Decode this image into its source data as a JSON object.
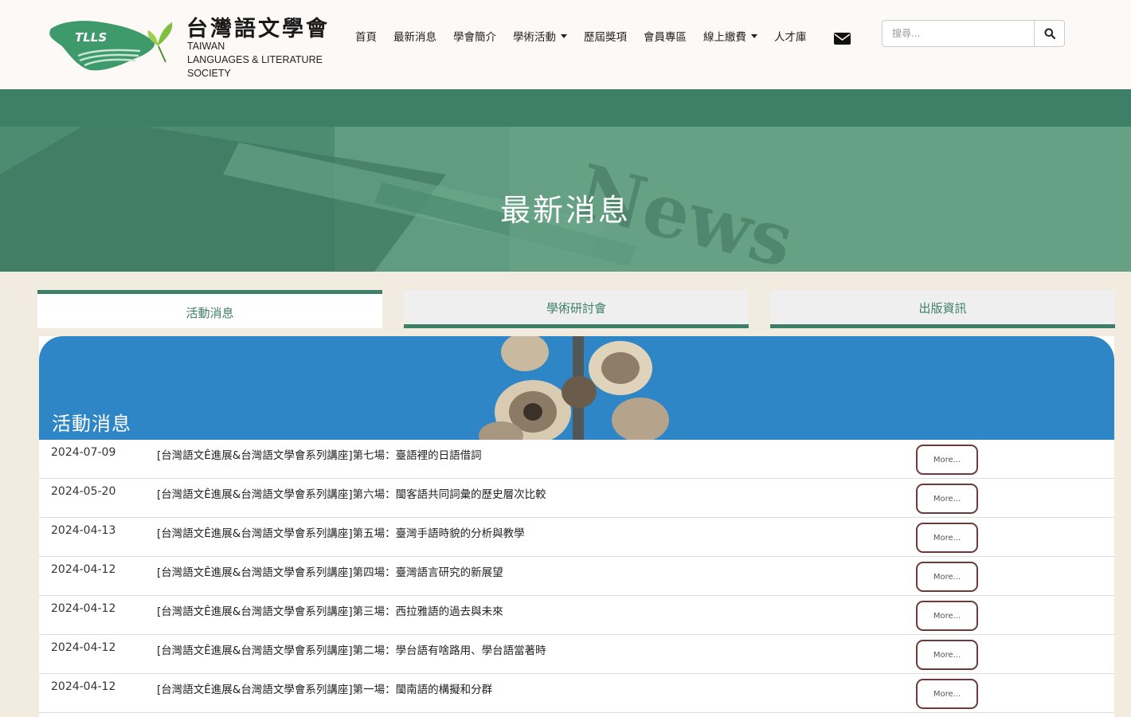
{
  "site": {
    "logo_mark_text": "TLLS",
    "title": "台灣語文學會",
    "subtitle_lines": [
      "TAIWAN",
      "LANGUAGES & LITERATURE",
      "SOCIETY"
    ]
  },
  "nav": {
    "items": [
      {
        "label": "首頁",
        "dropdown": false
      },
      {
        "label": "最新消息",
        "dropdown": false
      },
      {
        "label": "學會簡介",
        "dropdown": false
      },
      {
        "label": "學術活動",
        "dropdown": true
      },
      {
        "label": "歷屆獎項",
        "dropdown": false
      },
      {
        "label": "會員專區",
        "dropdown": false
      },
      {
        "label": "線上繳費",
        "dropdown": true
      },
      {
        "label": "人才庫",
        "dropdown": false
      }
    ],
    "mail_icon": "envelope-icon"
  },
  "search": {
    "placeholder": "搜尋...",
    "button_icon": "search-icon"
  },
  "hero": {
    "title": "最新消息",
    "background_word": "News"
  },
  "tabs": [
    {
      "label": "活動消息",
      "active": true
    },
    {
      "label": "學術研討會",
      "active": false
    },
    {
      "label": "出版資訊",
      "active": false
    }
  ],
  "panel": {
    "title": "活動消息",
    "more_label": "More...",
    "rows": [
      {
        "date": "2024-07-09",
        "title": "[台灣語文Ê進展&台灣語文學會系列講座]第七場：臺語裡的日語借詞"
      },
      {
        "date": "2024-05-20",
        "title": "[台灣語文Ê進展&台灣語文學會系列講座]第六場：閩客語共同詞彙的歷史層次比較"
      },
      {
        "date": "2024-04-13",
        "title": "[台灣語文Ê進展&台灣語文學會系列講座]第五場：臺灣手語時貌的分析與教學"
      },
      {
        "date": "2024-04-12",
        "title": "[台灣語文Ê進展&台灣語文學會系列講座]第四場：臺灣語言研究的新展望"
      },
      {
        "date": "2024-04-12",
        "title": "[台灣語文Ê進展&台灣語文學會系列講座]第三場：西拉雅語的過去與未來"
      },
      {
        "date": "2024-04-12",
        "title": "[台灣語文Ê進展&台灣語文學會系列講座]第二場：學台語有啥路用、學台語當著時"
      },
      {
        "date": "2024-04-12",
        "title": "[台灣語文Ê進展&台灣語文學會系列講座]第一場：閩南語的構擬和分群"
      }
    ]
  },
  "colors": {
    "brand_green": "#3e7f67",
    "hero_green": "#5f9c81",
    "banner_blue": "#2f86c6",
    "more_border": "#6b3a3a",
    "page_bg": "#f1ebe0"
  }
}
